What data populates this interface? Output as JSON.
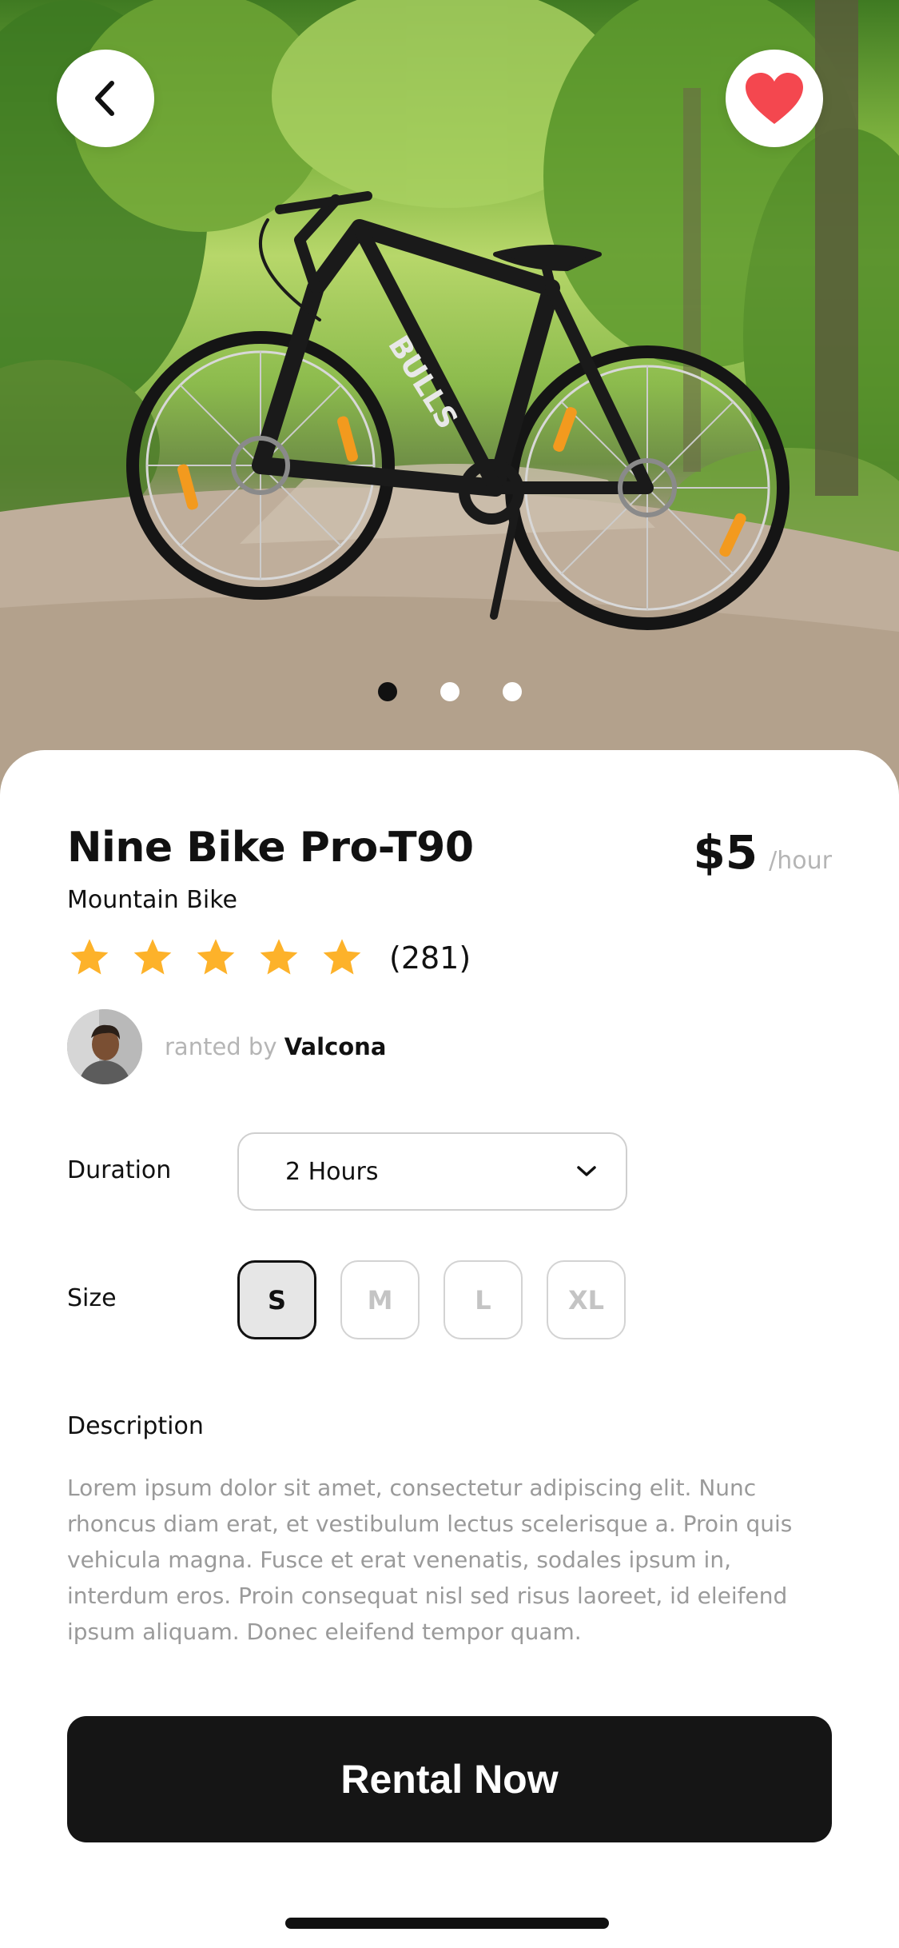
{
  "hero": {
    "image_alt": "Black mountain bike standing on a gravel path in a forest",
    "bike_brand_text": "BULLS",
    "carousel": {
      "count": 3,
      "active_index": 0
    }
  },
  "header": {
    "back_icon": "chevron-left-icon",
    "favorite_icon": "heart-icon",
    "favorite_color": "#f4474f",
    "favorited": true
  },
  "product": {
    "name": "Nine Bike Pro-T90",
    "category": "Mountain Bike",
    "price": "$5",
    "price_unit": "/hour",
    "rating_stars": 5,
    "rating_max": 5,
    "star_color": "#fdb22a",
    "rating_count": "(281)"
  },
  "owner": {
    "prefix": "ranted by",
    "name": "Valcona"
  },
  "duration": {
    "label": "Duration",
    "selected": "2 Hours",
    "dropdown_icon": "chevron-down-icon"
  },
  "size": {
    "label": "Size",
    "options": [
      "S",
      "M",
      "L",
      "XL"
    ],
    "selected": "S"
  },
  "description": {
    "title": "Description",
    "body": "Lorem ipsum dolor sit amet, consectetur adipiscing elit. Nunc rhoncus diam erat, et vestibulum lectus scelerisque a. Proin quis vehicula magna. Fusce et erat venenatis, sodales ipsum in, interdum eros. Proin consequat nisl sed risus laoreet, id eleifend ipsum aliquam. Donec eleifend tempor quam."
  },
  "cta": {
    "label": "Rental Now"
  }
}
